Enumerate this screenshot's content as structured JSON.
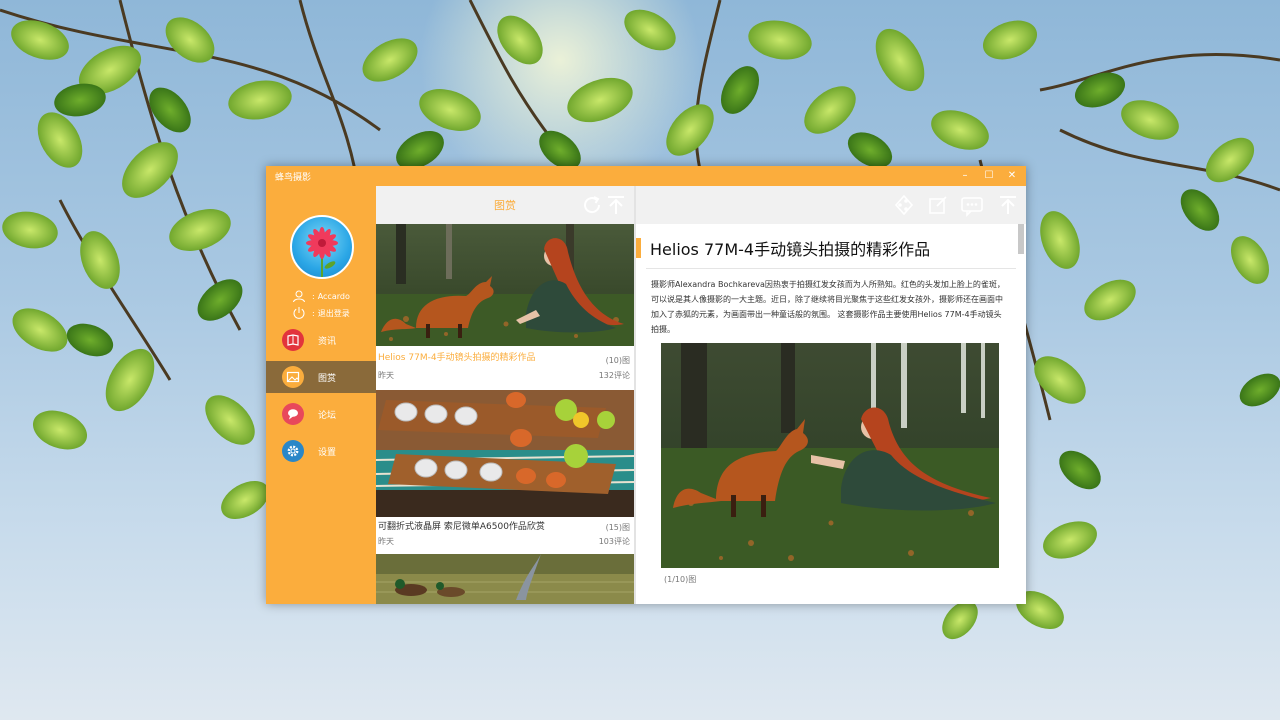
{
  "app": {
    "title": "蜂鸟摄影"
  },
  "window_controls": {
    "minimize": "–",
    "maximize": "☐",
    "close": "✕"
  },
  "user": {
    "name": "Accardo",
    "logout": "退出登录",
    "name_prefix": ":",
    "logout_prefix": ":"
  },
  "nav": {
    "items": [
      {
        "label": "资讯",
        "icon": "book-icon",
        "color": "#e2343c"
      },
      {
        "label": "图赏",
        "icon": "image-icon",
        "color": "#fbad3d"
      },
      {
        "label": "论坛",
        "icon": "chat-icon",
        "color": "#e8485b"
      },
      {
        "label": "设置",
        "icon": "gear-icon",
        "color": "#2a87c8"
      }
    ],
    "active_index": 1
  },
  "list": {
    "title": "图赏",
    "items": [
      {
        "title": "Helios 77M-4手动镜头拍摄的精彩作品",
        "count": "(10)图",
        "date": "昨天",
        "comments": "132评论",
        "highlighted": true
      },
      {
        "title": "可翻折式液晶屏 索尼微单A6500作品欣赏",
        "count": "(15)图",
        "date": "昨天",
        "comments": "103评论",
        "highlighted": false
      },
      {
        "title": "",
        "count": "",
        "date": "",
        "comments": "",
        "highlighted": false
      }
    ]
  },
  "detail": {
    "title": "Helios 77M-4手动镜头拍摄的精彩作品",
    "body": "摄影师Alexandra Bochkareva因热衷于拍摄红发女孩而为人所熟知。红色的头发加上脸上的雀斑，可以说是其人像摄影的一大主题。近日，除了继续将目光聚焦于这些红发女孩外，摄影师还在画面中加入了赤狐的元素，为画面带出一种童话般的氛围。 这套摄影作品主要使用Helios 77M-4手动镜头拍摄。",
    "caption": "(1/10)图"
  },
  "colors": {
    "accent": "#fbad3d",
    "active_nav": "#8a6a3a",
    "header_bg": "#f1f1f1"
  }
}
